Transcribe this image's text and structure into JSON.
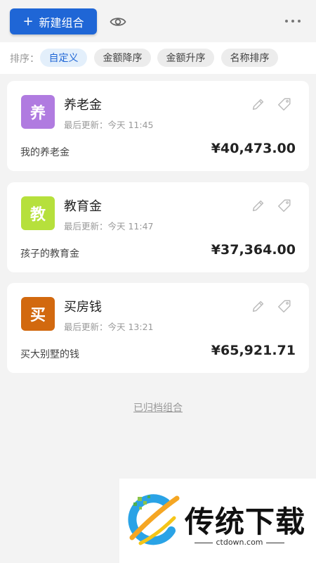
{
  "header": {
    "new_button_plus": "+",
    "new_button_label": "新建组合"
  },
  "sort": {
    "label": "排序：",
    "options": [
      "自定义",
      "金额降序",
      "金额升序",
      "名称排序"
    ],
    "active_index": 0
  },
  "cards": [
    {
      "avatar_char": "养",
      "avatar_color": "#b07be0",
      "title": "养老金",
      "updated": "最后更新：今天 11:45",
      "description": "我的养老金",
      "amount": "¥40,473.00"
    },
    {
      "avatar_char": "教",
      "avatar_color": "#b6e03c",
      "title": "教育金",
      "updated": "最后更新：今天 11:47",
      "description": "孩子的教育金",
      "amount": "¥37,364.00"
    },
    {
      "avatar_char": "买",
      "avatar_color": "#d2690f",
      "title": "买房钱",
      "updated": "最后更新：今天 13:21",
      "description": "买大别墅的钱",
      "amount": "¥65,921.71"
    }
  ],
  "footer": {
    "archived_link": "已归档组合"
  },
  "watermark": {
    "brand": "传统下载",
    "url": "ctdown.com"
  },
  "colors": {
    "primary": "#1f66d6",
    "background": "#f3f3f3",
    "card": "#ffffff"
  },
  "icons": {
    "eye": "eye-icon",
    "more": "more-icon",
    "edit": "pencil-icon",
    "tag": "tag-icon"
  }
}
